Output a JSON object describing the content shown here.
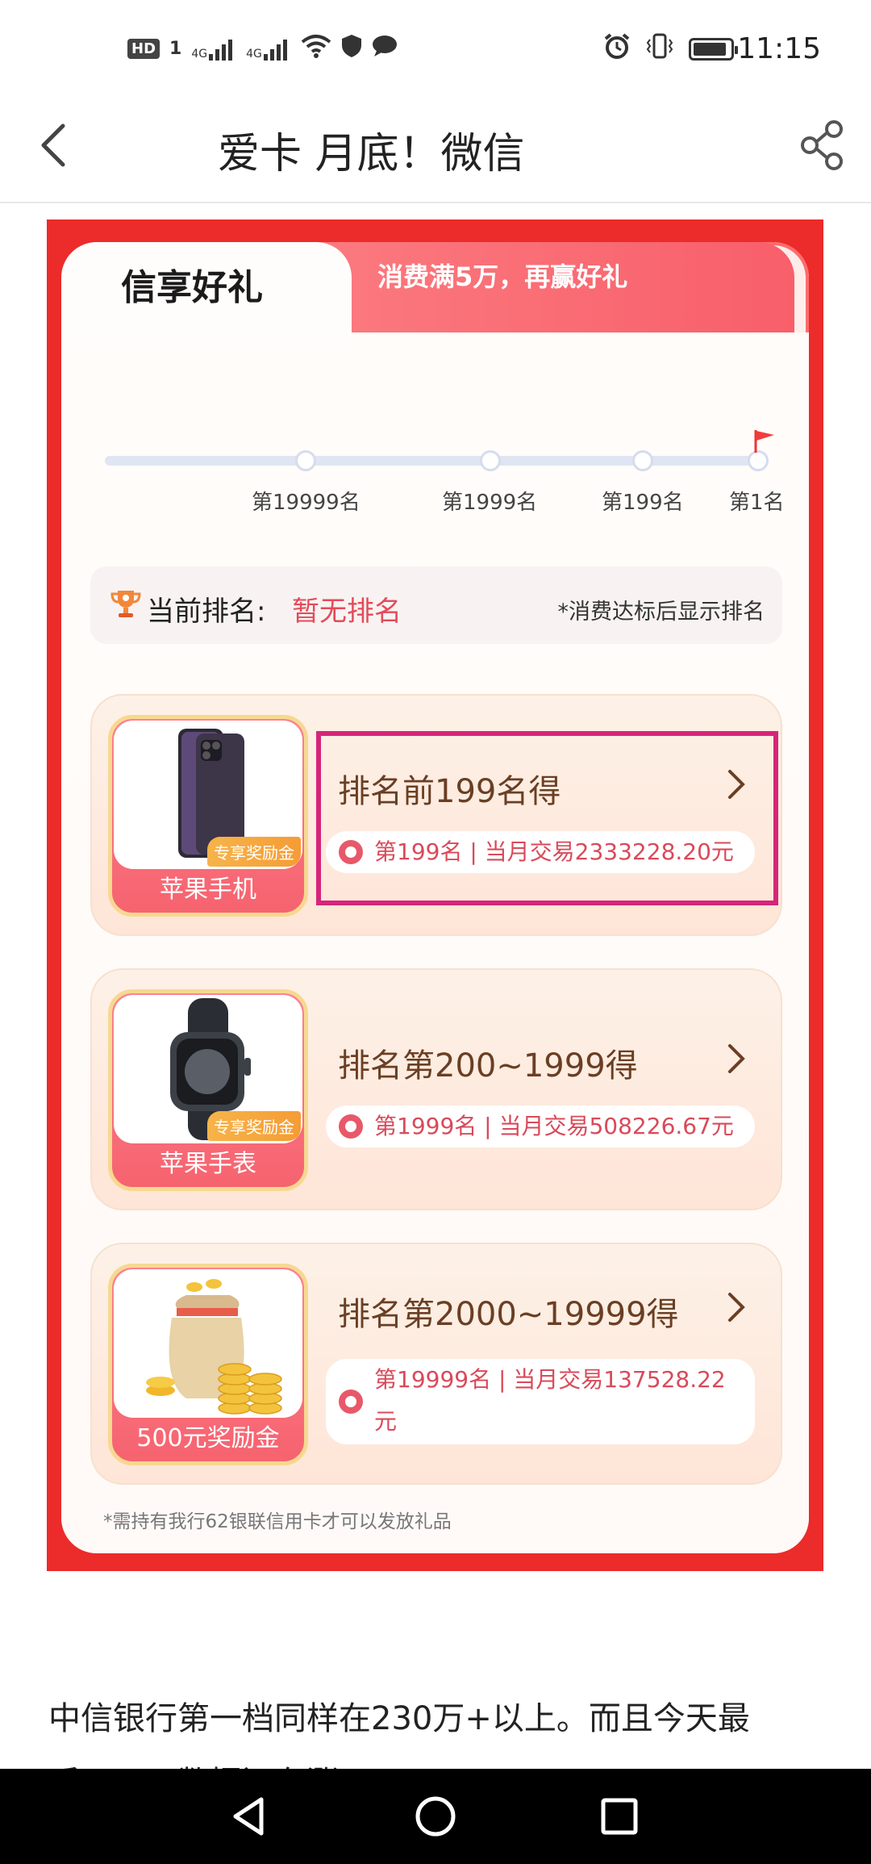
{
  "status_bar": {
    "time": "11:15",
    "hd_label": "HD",
    "sim_label": "1",
    "network_1": "4G",
    "network_2": "4G",
    "icons_left": [
      "hd-icon",
      "signal-icon",
      "signal-icon",
      "wifi-icon",
      "shield-icon",
      "chat-bubble-icon"
    ],
    "icons_right": [
      "alarm-icon",
      "vibrate-icon",
      "battery-icon"
    ]
  },
  "header": {
    "title_marquee": "爱卡        月底！微信",
    "back_icon": "chevron-left-icon",
    "share_icon": "share-icon"
  },
  "poster": {
    "tab_active": "信享好礼",
    "tab_inactive": "消费满5万，再赢好礼",
    "milestones": [
      {
        "label": "第19999名"
      },
      {
        "label": "第1999名"
      },
      {
        "label": "第199名"
      },
      {
        "label": "第1名"
      }
    ],
    "rank": {
      "label": "当前排名:",
      "value": "暂无排名",
      "note": "*消费达标后显示排名"
    },
    "prizes": [
      {
        "caption": "苹果手机",
        "badge": "专享奖励金",
        "title": "排名前199名得",
        "info": "第199名 | 当月交易2333228.20元"
      },
      {
        "caption": "苹果手表",
        "badge": "专享奖励金",
        "title": "排名第200~1999得",
        "info": "第1999名 | 当月交易508226.67元"
      },
      {
        "caption": "500元奖励金",
        "badge": "",
        "title": "排名第2000~19999得",
        "info_line1": "第19999名 | 当月交易137528.22",
        "info_line2": "元"
      }
    ],
    "footnote": "*需持有我行62银联信用卡才可以发放礼品"
  },
  "article": {
    "line1": "中信银行第一档同样在230万+以上。而且今天最",
    "line2": "后一天，数据还在涨!"
  },
  "colors": {
    "poster_red": "#ec2b2b",
    "accent_pink": "#e44b5a",
    "highlight_border": "#d6257a"
  }
}
